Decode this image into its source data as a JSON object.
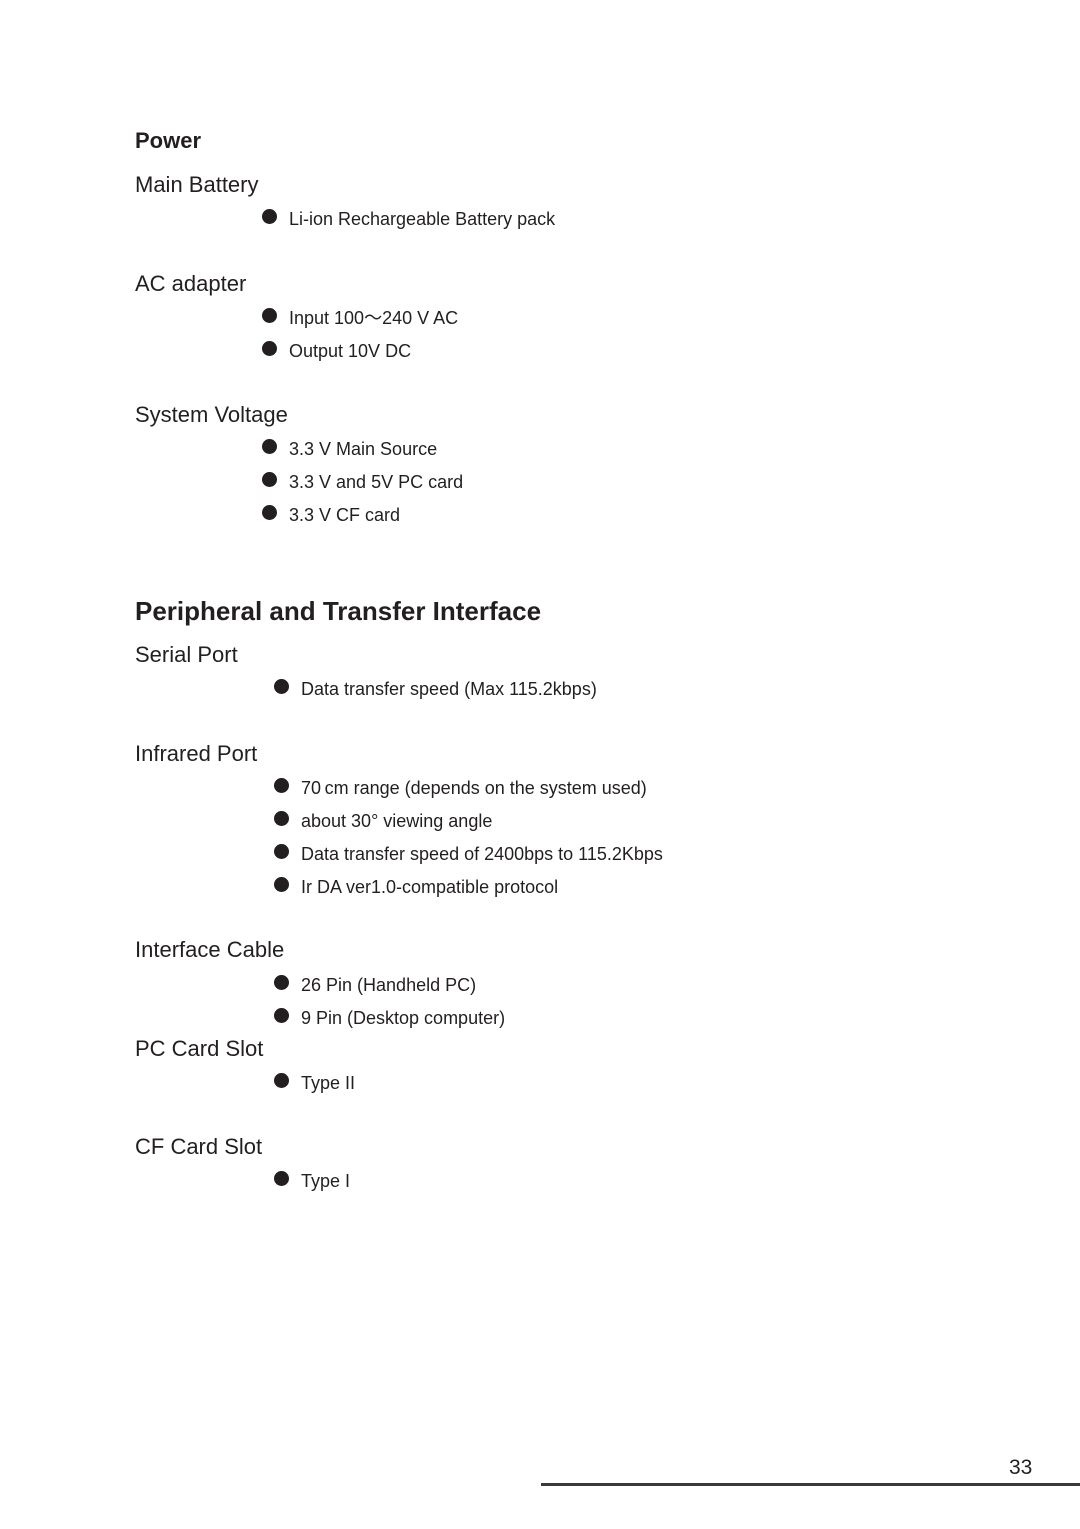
{
  "power": {
    "title": "Power",
    "main_battery": {
      "title": "Main Battery",
      "items": [
        "Li-ion Rechargeable Battery pack"
      ]
    },
    "ac_adapter": {
      "title": "AC adapter",
      "items": [
        "Input 100〜240 V AC",
        "Output 10V DC"
      ]
    },
    "system_voltage": {
      "title": "System Voltage",
      "items": [
        "3.3 V Main Source",
        "3.3 V and 5V  PC card",
        "3.3 V CF card"
      ]
    }
  },
  "peripheral": {
    "title": "Peripheral and Transfer Interface",
    "serial_port": {
      "title": "Serial Port",
      "items": [
        "Data transfer speed  (Max 115.2kbps)"
      ]
    },
    "infrared_port": {
      "title": "Infrared Port",
      "items": [
        "70 cm range (depends on the system used)",
        "about 30°  viewing angle",
        "Data transfer speed of 2400bps to 115.2Kbps",
        "Ir DA ver1.0-compatible protocol"
      ]
    },
    "interface_cable": {
      "title": "Interface Cable",
      "items": [
        "26 Pin (Handheld PC)",
        "9 Pin (Desktop computer)"
      ]
    },
    "pc_card_slot": {
      "title": "PC Card Slot",
      "items": [
        "Type II"
      ]
    },
    "cf_card_slot": {
      "title": "CF Card Slot",
      "items": [
        "Type I"
      ]
    }
  },
  "footer": {
    "page_number": "33"
  },
  "icons": {
    "bullet": "filled-circle"
  }
}
